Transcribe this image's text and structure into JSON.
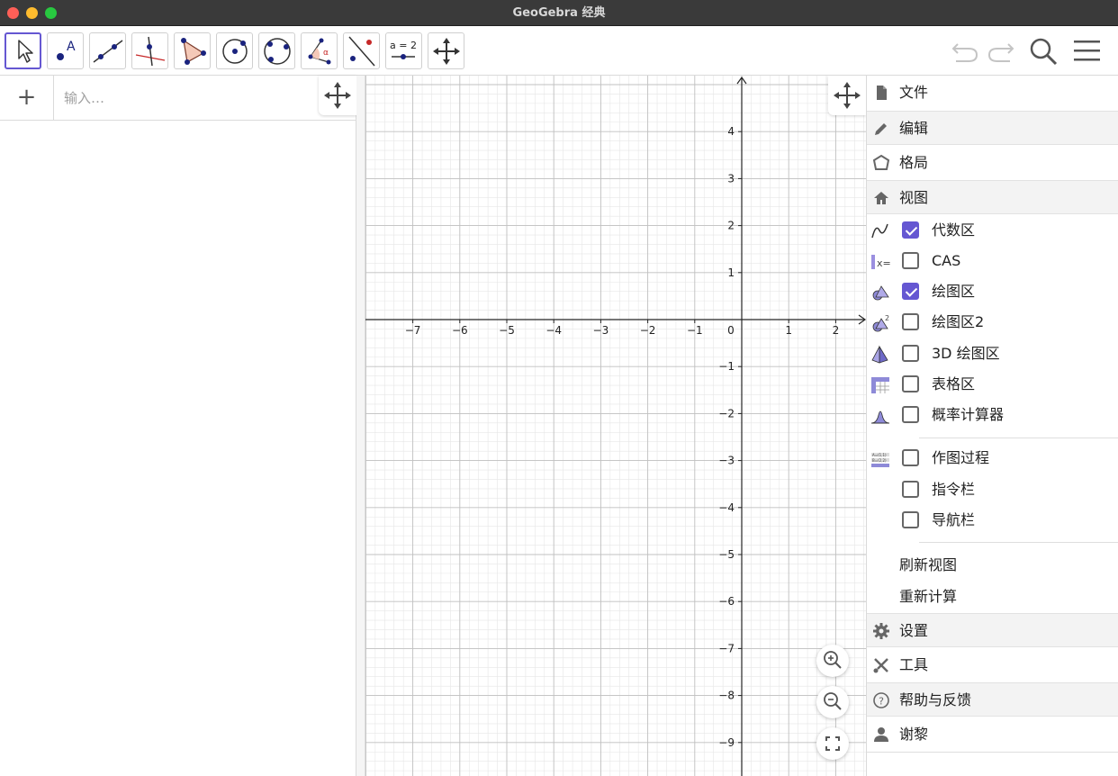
{
  "window": {
    "title": "GeoGebra 经典"
  },
  "toolbar": {
    "tools": [
      {
        "name": "move-tool",
        "icon": "arrow-cursor-icon",
        "selected": true
      },
      {
        "name": "point-tool",
        "icon": "point-icon"
      },
      {
        "name": "line-tool",
        "icon": "line-icon"
      },
      {
        "name": "perpendicular-tool",
        "icon": "perpendicular-line-icon"
      },
      {
        "name": "polygon-tool",
        "icon": "polygon-icon"
      },
      {
        "name": "circle-tool",
        "icon": "circle-center-icon"
      },
      {
        "name": "circle-three-points-tool",
        "icon": "circle-three-points-icon"
      },
      {
        "name": "angle-tool",
        "icon": "angle-icon"
      },
      {
        "name": "reflect-tool",
        "icon": "reflect-icon"
      },
      {
        "name": "slider-tool",
        "icon": "slider-icon",
        "text": "a = 2"
      },
      {
        "name": "move-graphics-tool",
        "icon": "move-arrows-icon"
      }
    ],
    "right": [
      "undo-icon",
      "redo-icon",
      "search-icon",
      "menu-icon"
    ]
  },
  "algebra": {
    "input_placeholder": "输入…",
    "plus_label": "+"
  },
  "graphics": {
    "x_ticks": [
      "−7",
      "−6",
      "−5",
      "−4",
      "−3",
      "−2",
      "−1",
      "0",
      "1",
      "2"
    ],
    "y_ticks_pos": [
      "4",
      "3",
      "2",
      "1"
    ],
    "y_ticks_neg": [
      "−1",
      "−2",
      "−3",
      "−4",
      "−5",
      "−6",
      "−7",
      "−8",
      "−9"
    ],
    "axis_color": "#252525",
    "grid_major_color": "#c0c0c0",
    "grid_minor_color": "#e6e6e6"
  },
  "menu": {
    "accent": "#6557d2",
    "items": {
      "file": "文件",
      "edit": "编辑",
      "layout": "格局",
      "view": "视图",
      "settings": "设置",
      "tools": "工具",
      "help": "帮助与反馈",
      "user": "谢黎"
    },
    "views": [
      {
        "label": "代数区",
        "checked": true,
        "icon": "algebra-view-icon"
      },
      {
        "label": "CAS",
        "checked": false,
        "icon": "cas-view-icon"
      },
      {
        "label": "绘图区",
        "checked": true,
        "icon": "graphics-view-icon"
      },
      {
        "label": "绘图区2",
        "checked": false,
        "icon": "graphics2-view-icon"
      },
      {
        "label": "3D 绘图区",
        "checked": false,
        "icon": "3d-graphics-icon"
      },
      {
        "label": "表格区",
        "checked": false,
        "icon": "spreadsheet-icon"
      },
      {
        "label": "概率计算器",
        "checked": false,
        "icon": "probability-icon"
      }
    ],
    "extras": [
      {
        "label": "作图过程",
        "checked": false,
        "icon": "construction-protocol-icon"
      },
      {
        "label": "指令栏",
        "checked": false
      },
      {
        "label": "导航栏",
        "checked": false
      }
    ],
    "refresh": "刷新视图",
    "recompute": "重新计算"
  }
}
